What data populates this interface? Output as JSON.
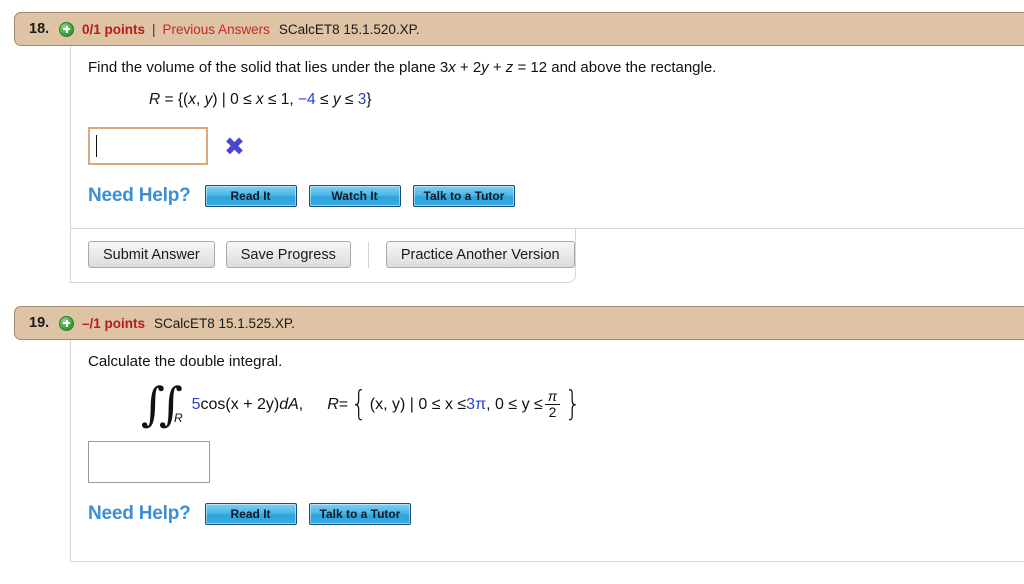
{
  "colors": {
    "header_bg": "#dec3a4",
    "points_red": "#b71c1c",
    "link_red": "#c62828",
    "help_blue": "#3b8fd4",
    "math_blue": "#2a3fd4",
    "wrong_x": "#4b47cf",
    "input_border_wrong": "#d9a97e"
  },
  "problems": [
    {
      "number": "18.",
      "expand_icon": "plus-circle-icon",
      "points": "0/1 points",
      "separator": "|",
      "previous_answers": "Previous Answers",
      "code": "SCalcET8 15.1.520.XP.",
      "question": {
        "part1": "Find the volume of the solid that lies under the plane 3",
        "var_x": "x",
        "part2": " + 2",
        "var_y": "y",
        "part3": " + ",
        "var_z": "z",
        "part4": " = 12 and above the rectangle."
      },
      "set_line": {
        "R": "R",
        "eq": " = {(",
        "x": "x",
        "comma": ", ",
        "y": "y",
        "bar": ") | 0 ≤ ",
        "x2": "x",
        "le1": " ≤ 1, ",
        "lower": "−4",
        "le2": " ≤ ",
        "y2": "y",
        "le3": " ≤ ",
        "upper": "3",
        "close": "}"
      },
      "answer_value": "",
      "answer_state": "wrong",
      "wrong_mark": "✖",
      "help_label": "Need Help?",
      "help_buttons": [
        "Read It",
        "Watch It",
        "Talk to a Tutor"
      ],
      "toolbar_buttons": [
        "Submit Answer",
        "Save Progress",
        "Practice Another Version"
      ]
    },
    {
      "number": "19.",
      "expand_icon": "plus-circle-icon",
      "points": "–/1 points",
      "code": "SCalcET8 15.1.525.XP.",
      "question_text": "Calculate the double integral.",
      "integral": {
        "symbol": "∫",
        "subscript": "R",
        "coefficient": "5",
        "integrand": " cos(x + 2y) ",
        "differential": "dA",
        "comma": ",",
        "R_label": "R",
        "equals": " = ",
        "brace_open": "{",
        "set_vars": "(x, y) | 0 ≤ x ≤ ",
        "x_upper": "3π",
        "set_mid": ", 0 ≤ y ≤ ",
        "frac_num": "π",
        "frac_den": "2",
        "brace_close": "}"
      },
      "answer_value": "",
      "answer_state": "plain",
      "help_label": "Need Help?",
      "help_buttons": [
        "Read It",
        "Talk to a Tutor"
      ]
    }
  ]
}
